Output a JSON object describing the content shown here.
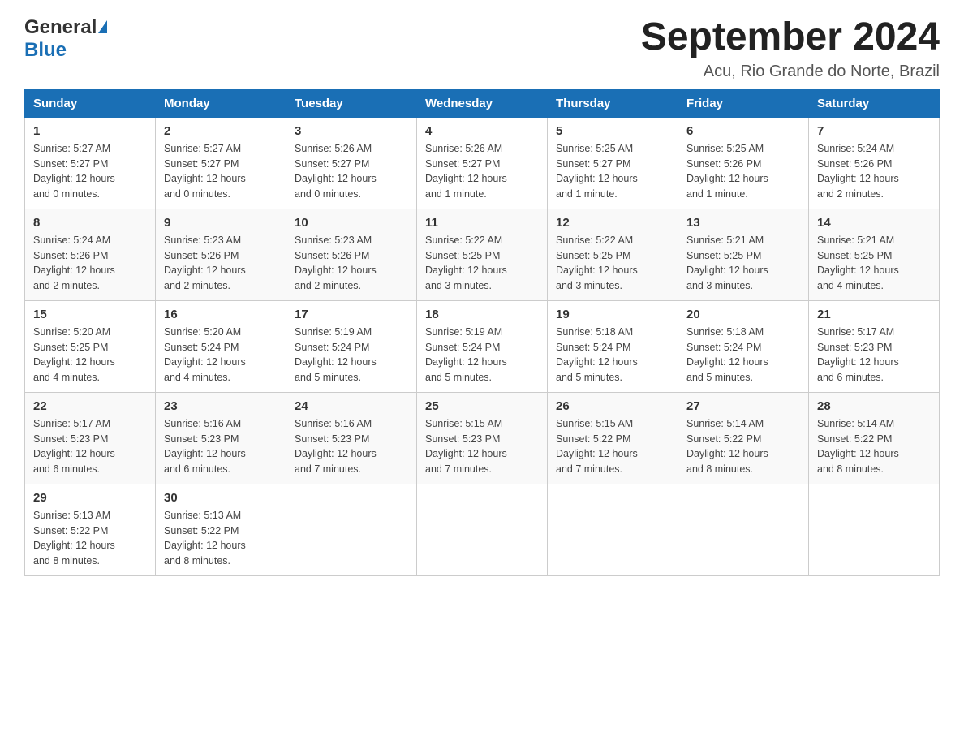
{
  "header": {
    "title": "September 2024",
    "subtitle": "Acu, Rio Grande do Norte, Brazil"
  },
  "logo": {
    "general": "General",
    "blue": "Blue"
  },
  "days_of_week": [
    "Sunday",
    "Monday",
    "Tuesday",
    "Wednesday",
    "Thursday",
    "Friday",
    "Saturday"
  ],
  "weeks": [
    [
      {
        "day": "1",
        "sunrise": "5:27 AM",
        "sunset": "5:27 PM",
        "daylight": "12 hours and 0 minutes."
      },
      {
        "day": "2",
        "sunrise": "5:27 AM",
        "sunset": "5:27 PM",
        "daylight": "12 hours and 0 minutes."
      },
      {
        "day": "3",
        "sunrise": "5:26 AM",
        "sunset": "5:27 PM",
        "daylight": "12 hours and 0 minutes."
      },
      {
        "day": "4",
        "sunrise": "5:26 AM",
        "sunset": "5:27 PM",
        "daylight": "12 hours and 1 minute."
      },
      {
        "day": "5",
        "sunrise": "5:25 AM",
        "sunset": "5:27 PM",
        "daylight": "12 hours and 1 minute."
      },
      {
        "day": "6",
        "sunrise": "5:25 AM",
        "sunset": "5:26 PM",
        "daylight": "12 hours and 1 minute."
      },
      {
        "day": "7",
        "sunrise": "5:24 AM",
        "sunset": "5:26 PM",
        "daylight": "12 hours and 2 minutes."
      }
    ],
    [
      {
        "day": "8",
        "sunrise": "5:24 AM",
        "sunset": "5:26 PM",
        "daylight": "12 hours and 2 minutes."
      },
      {
        "day": "9",
        "sunrise": "5:23 AM",
        "sunset": "5:26 PM",
        "daylight": "12 hours and 2 minutes."
      },
      {
        "day": "10",
        "sunrise": "5:23 AM",
        "sunset": "5:26 PM",
        "daylight": "12 hours and 2 minutes."
      },
      {
        "day": "11",
        "sunrise": "5:22 AM",
        "sunset": "5:25 PM",
        "daylight": "12 hours and 3 minutes."
      },
      {
        "day": "12",
        "sunrise": "5:22 AM",
        "sunset": "5:25 PM",
        "daylight": "12 hours and 3 minutes."
      },
      {
        "day": "13",
        "sunrise": "5:21 AM",
        "sunset": "5:25 PM",
        "daylight": "12 hours and 3 minutes."
      },
      {
        "day": "14",
        "sunrise": "5:21 AM",
        "sunset": "5:25 PM",
        "daylight": "12 hours and 4 minutes."
      }
    ],
    [
      {
        "day": "15",
        "sunrise": "5:20 AM",
        "sunset": "5:25 PM",
        "daylight": "12 hours and 4 minutes."
      },
      {
        "day": "16",
        "sunrise": "5:20 AM",
        "sunset": "5:24 PM",
        "daylight": "12 hours and 4 minutes."
      },
      {
        "day": "17",
        "sunrise": "5:19 AM",
        "sunset": "5:24 PM",
        "daylight": "12 hours and 5 minutes."
      },
      {
        "day": "18",
        "sunrise": "5:19 AM",
        "sunset": "5:24 PM",
        "daylight": "12 hours and 5 minutes."
      },
      {
        "day": "19",
        "sunrise": "5:18 AM",
        "sunset": "5:24 PM",
        "daylight": "12 hours and 5 minutes."
      },
      {
        "day": "20",
        "sunrise": "5:18 AM",
        "sunset": "5:24 PM",
        "daylight": "12 hours and 5 minutes."
      },
      {
        "day": "21",
        "sunrise": "5:17 AM",
        "sunset": "5:23 PM",
        "daylight": "12 hours and 6 minutes."
      }
    ],
    [
      {
        "day": "22",
        "sunrise": "5:17 AM",
        "sunset": "5:23 PM",
        "daylight": "12 hours and 6 minutes."
      },
      {
        "day": "23",
        "sunrise": "5:16 AM",
        "sunset": "5:23 PM",
        "daylight": "12 hours and 6 minutes."
      },
      {
        "day": "24",
        "sunrise": "5:16 AM",
        "sunset": "5:23 PM",
        "daylight": "12 hours and 7 minutes."
      },
      {
        "day": "25",
        "sunrise": "5:15 AM",
        "sunset": "5:23 PM",
        "daylight": "12 hours and 7 minutes."
      },
      {
        "day": "26",
        "sunrise": "5:15 AM",
        "sunset": "5:22 PM",
        "daylight": "12 hours and 7 minutes."
      },
      {
        "day": "27",
        "sunrise": "5:14 AM",
        "sunset": "5:22 PM",
        "daylight": "12 hours and 8 minutes."
      },
      {
        "day": "28",
        "sunrise": "5:14 AM",
        "sunset": "5:22 PM",
        "daylight": "12 hours and 8 minutes."
      }
    ],
    [
      {
        "day": "29",
        "sunrise": "5:13 AM",
        "sunset": "5:22 PM",
        "daylight": "12 hours and 8 minutes."
      },
      {
        "day": "30",
        "sunrise": "5:13 AM",
        "sunset": "5:22 PM",
        "daylight": "12 hours and 8 minutes."
      },
      {
        "day": "",
        "sunrise": "",
        "sunset": "",
        "daylight": ""
      },
      {
        "day": "",
        "sunrise": "",
        "sunset": "",
        "daylight": ""
      },
      {
        "day": "",
        "sunrise": "",
        "sunset": "",
        "daylight": ""
      },
      {
        "day": "",
        "sunrise": "",
        "sunset": "",
        "daylight": ""
      },
      {
        "day": "",
        "sunrise": "",
        "sunset": "",
        "daylight": ""
      }
    ]
  ],
  "labels": {
    "sunrise": "Sunrise:",
    "sunset": "Sunset:",
    "daylight": "Daylight:"
  }
}
